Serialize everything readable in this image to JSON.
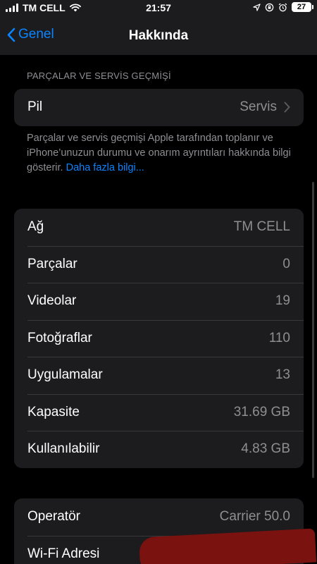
{
  "status_bar": {
    "carrier": "TM CELL",
    "time": "21:57",
    "battery": "27"
  },
  "nav": {
    "back_label": "Genel",
    "title": "Hakkında"
  },
  "parts_section": {
    "header": "PARÇALAR VE SERVİS GEÇMİŞİ",
    "rows": [
      {
        "label": "Pil",
        "value": "Servis"
      }
    ],
    "footer_text": "Parçalar ve servis geçmişi Apple tarafından toplanır ve iPhone’unuzun durumu ve onarım ayrıntıları hakkında bilgi gösterir. ",
    "footer_link": "Daha fazla bilgi..."
  },
  "info_section": {
    "rows": [
      {
        "label": "Ağ",
        "value": "TM CELL"
      },
      {
        "label": "Parçalar",
        "value": "0"
      },
      {
        "label": "Videolar",
        "value": "19"
      },
      {
        "label": "Fotoğraflar",
        "value": "110"
      },
      {
        "label": "Uygulamalar",
        "value": "13"
      },
      {
        "label": "Kapasite",
        "value": "31.69 GB"
      },
      {
        "label": "Kullanılabilir",
        "value": "4.83 GB"
      }
    ]
  },
  "carrier_section": {
    "rows": [
      {
        "label": "Operatör",
        "value": "Carrier 50.0"
      },
      {
        "label": "Wi-Fi Adresi",
        "value": ""
      }
    ]
  },
  "colors": {
    "accent": "#0a84ff",
    "cell_background": "#1c1c1e",
    "secondary_text": "#8e8e93",
    "redaction": "#7a1210"
  }
}
